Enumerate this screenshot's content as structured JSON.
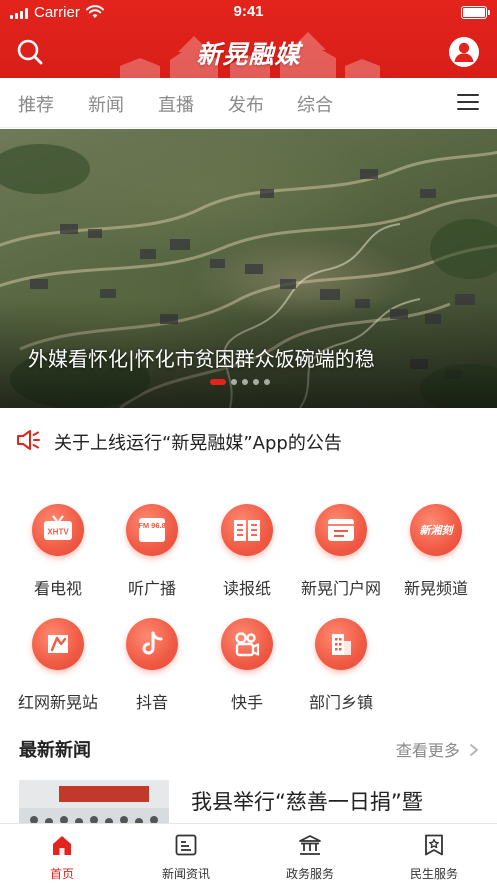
{
  "status_bar": {
    "carrier": "Carrier",
    "time": "9:41"
  },
  "app_bar": {
    "title": "新晃融媒"
  },
  "tabs": [
    {
      "label": "推荐"
    },
    {
      "label": "新闻"
    },
    {
      "label": "直播"
    },
    {
      "label": "发布"
    },
    {
      "label": "综合"
    }
  ],
  "banner": {
    "caption": "外媒看怀化|怀化市贫困群众饭碗端的稳",
    "slide_count": 5,
    "active_slide": 1
  },
  "notice": {
    "text": "关于上线运行“新晃融媒”App的公告"
  },
  "services": [
    {
      "label": "看电视",
      "icon": "tv-icon",
      "badge": "XHTV"
    },
    {
      "label": "听广播",
      "icon": "radio-icon",
      "badge": "FM 96.8"
    },
    {
      "label": "读报纸",
      "icon": "newspaper-icon"
    },
    {
      "label": "新晃门户网",
      "icon": "portal-icon"
    },
    {
      "label": "新晃频道",
      "icon": "channel-icon",
      "badge": "新湘刻"
    },
    {
      "label": "红网新晃站",
      "icon": "rednet-icon"
    },
    {
      "label": "抖音",
      "icon": "douyin-icon"
    },
    {
      "label": "快手",
      "icon": "kuaishou-icon"
    },
    {
      "label": "部门乡镇",
      "icon": "department-icon"
    }
  ],
  "latest_news": {
    "title": "最新新闻",
    "more": "查看更多",
    "items": [
      {
        "title": "我县举行“慈善一日捐”暨"
      }
    ]
  },
  "bottom_nav": [
    {
      "label": "首页",
      "icon": "home-icon",
      "active": true
    },
    {
      "label": "新闻资讯",
      "icon": "news-icon",
      "active": false
    },
    {
      "label": "政务服务",
      "icon": "government-icon",
      "active": false
    },
    {
      "label": "民生服务",
      "icon": "livelihood-icon",
      "active": false
    }
  ],
  "colors": {
    "brand_red": "#e3241d",
    "icon_coral": "#f05a44",
    "muted_text": "#8a8a8a"
  }
}
